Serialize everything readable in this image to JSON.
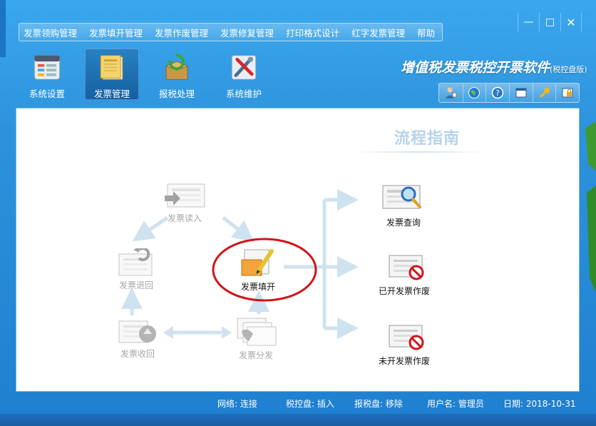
{
  "menu": [
    "发票领购管理",
    "发票填开管理",
    "发票作废管理",
    "发票修复管理",
    "打印格式设计",
    "红字发票管理",
    "帮助"
  ],
  "toolbar": [
    {
      "label": "系统设置",
      "icon": "settings-panel-icon"
    },
    {
      "label": "发票管理",
      "icon": "notebook-icon",
      "active": true
    },
    {
      "label": "报税处理",
      "icon": "package-upload-icon"
    },
    {
      "label": "系统维护",
      "icon": "tools-icon"
    }
  ],
  "brand": {
    "title": "增值税发票税控开票软件",
    "edition": "(税控盘版)"
  },
  "window_controls": {
    "minimize": "—",
    "maximize": "□",
    "close": "✕"
  },
  "guide": {
    "title": "流程指南",
    "nodes": {
      "read": "发票读入",
      "return": "发票退回",
      "recycle": "发票收回",
      "fill": "发票填开",
      "distribute": "发票分发",
      "query": "发票查询",
      "void_issued": "已开发票作废",
      "void_unissued": "未开发票作废"
    }
  },
  "status": {
    "network": "网络: 连接",
    "tax_disk": "税控盘: 插入",
    "report_disk": "报税盘: 移除",
    "user": "用户名: 管理员",
    "date": "日期: 2018-10-31"
  },
  "colors": {
    "accent": "#2d93dc",
    "arrow": "#cfe2ef",
    "highlight": "#d0141a"
  }
}
